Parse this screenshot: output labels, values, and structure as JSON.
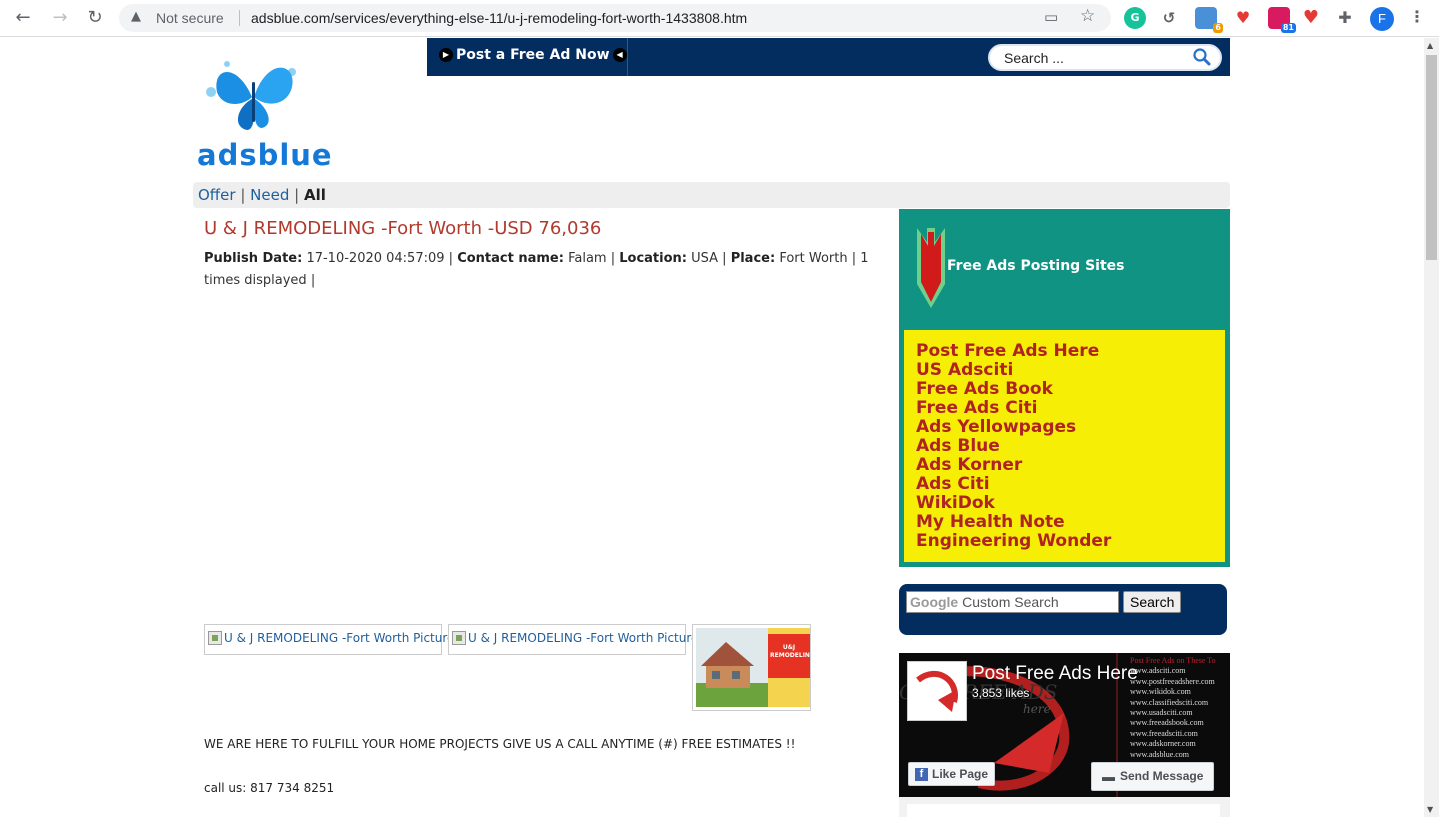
{
  "browser": {
    "security_label": "Not secure",
    "url": "adsblue.com/services/everything-else-11/u-j-remodeling-fort-worth-1433808.htm",
    "extensions": [
      {
        "name": "grammarly",
        "letter": "G",
        "color": "#15c39a"
      },
      {
        "name": "history",
        "letter": "↺",
        "color": "#5f6368"
      },
      {
        "name": "ext-badge-6",
        "letter": "",
        "color": "#4a90d9",
        "badge": "6",
        "badge_color": "#f29900"
      },
      {
        "name": "ext-heart-broken",
        "letter": "",
        "color": "#e53935"
      },
      {
        "name": "ext-badge-81",
        "letter": "",
        "color": "#d81b60",
        "badge": "81",
        "badge_color": "#1a73e8"
      },
      {
        "name": "heart",
        "letter": "♥",
        "color": "#fff"
      },
      {
        "name": "puzzle",
        "letter": "",
        "color": "#fff"
      }
    ],
    "profile_initial": "F"
  },
  "topbar": {
    "post_ad_label": "Post a Free Ad Now",
    "search_placeholder": "Search ..."
  },
  "logo": {
    "text": "adsblue"
  },
  "filter": {
    "offer": "Offer",
    "need": "Need",
    "all": "All",
    "separator": "|"
  },
  "ad": {
    "title": "U & J REMODELING -Fort Worth -USD 76,036",
    "publish_label": "Publish Date:",
    "publish_value": "17-10-2020 04:57:09",
    "contact_label": "Contact name:",
    "contact_value": "Falam",
    "location_label": "Location:",
    "location_value": "USA",
    "place_label": "Place:",
    "place_value": "Fort Worth",
    "displayed": "1 times displayed",
    "images": [
      {
        "alt": "U & J REMODELING -Fort Worth Picture"
      },
      {
        "alt": "U & J REMODELING -Fort Worth Picture"
      }
    ],
    "description": "WE ARE HERE TO FULFILL YOUR HOME PROJECTS GIVE US A CALL ANYTIME (#) FREE ESTIMATES !!",
    "phone": "call us: 817 734 8251",
    "sign_text": "U&J REMODELING"
  },
  "sidebar": {
    "green_title": "Free Ads Posting Sites",
    "links": [
      "Post Free Ads Here",
      "US Adsciti",
      "Free Ads Book",
      "Free Ads Citi",
      "Ads Yellowpages",
      "Ads Blue",
      "Ads Korner",
      "Ads Citi",
      "WikiDok",
      "My Health Note",
      "Engineering Wonder"
    ],
    "google_word": "Google",
    "custom_search_placeholder": "Custom Search",
    "search_button": "Search",
    "facebook": {
      "page_title": "Post Free Ads Here",
      "likes": "3,853 likes",
      "like_button": "Like Page",
      "message_button": "Send Message",
      "list_header": "Post Free Ads on These To",
      "sites": [
        "www.adsciti.com",
        "www.postfreeadshere.com",
        "www.wikidok.com",
        "www.classifiedsciti.com",
        "www.usadsciti.com",
        "www.freeadsbook.com",
        "www.freeadsciti.com",
        "www.adskorner.com",
        "www.adsblue.com"
      ]
    }
  }
}
